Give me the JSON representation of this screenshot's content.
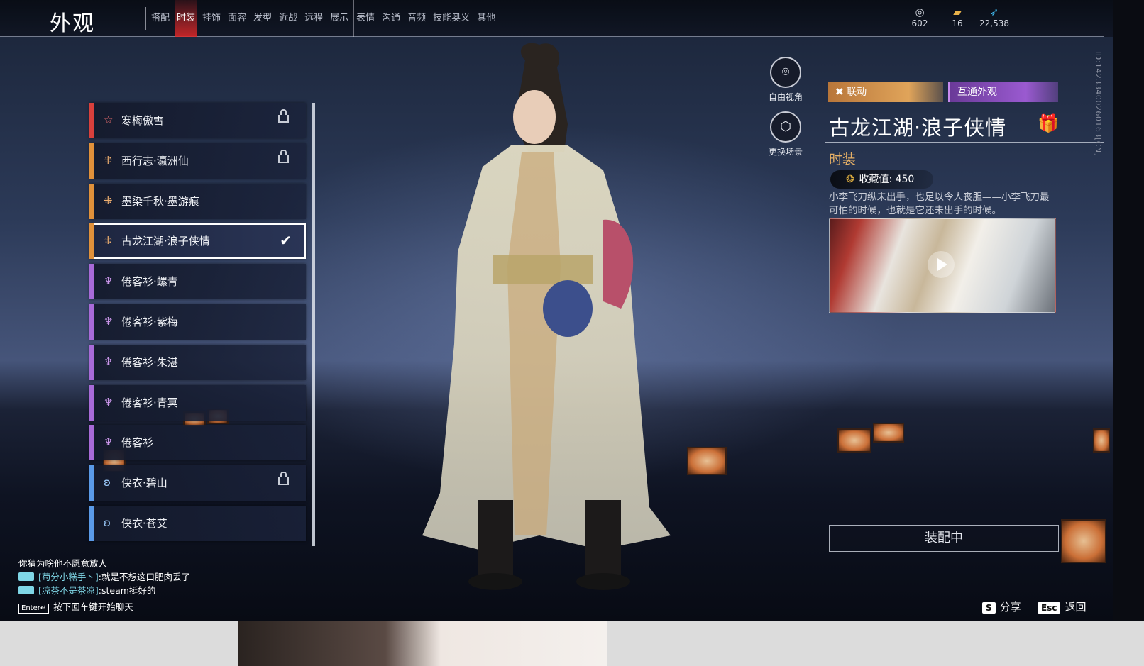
{
  "header": {
    "title": "外观",
    "tabs": [
      {
        "label": "搭配"
      },
      {
        "label": "时装",
        "active": true
      },
      {
        "label": "挂饰"
      },
      {
        "label": "面容"
      },
      {
        "label": "发型"
      },
      {
        "label": "近战"
      },
      {
        "label": "远程"
      },
      {
        "label": "展示"
      },
      {
        "label": "表情"
      },
      {
        "label": "沟通"
      },
      {
        "label": "音频"
      },
      {
        "label": "技能奥义"
      },
      {
        "label": "其他"
      }
    ],
    "currencies": [
      {
        "icon": "jade-icon",
        "value": "602"
      },
      {
        "icon": "ticket-icon",
        "value": "16"
      },
      {
        "icon": "feather-icon",
        "value": "22,538"
      }
    ]
  },
  "outfit_list": {
    "items": [
      {
        "label": "寒梅傲雪",
        "rarity_color": "#d8403c",
        "icon": "star-icon",
        "locked": true,
        "selected": false
      },
      {
        "label": "西行志·瀛洲仙",
        "rarity_color": "#e0913a",
        "icon": "cross-icon",
        "locked": true,
        "selected": false
      },
      {
        "label": "墨染千秋·墨游痕",
        "rarity_color": "#e0913a",
        "icon": "cross-icon",
        "locked": false,
        "selected": false
      },
      {
        "label": "古龙江湖·浪子侠情",
        "rarity_color": "#e0913a",
        "icon": "cross-icon",
        "locked": false,
        "selected": true
      },
      {
        "label": "倦客衫·螺青",
        "rarity_color": "#a86ad8",
        "icon": "trident-icon",
        "locked": false,
        "selected": false
      },
      {
        "label": "倦客衫·紫梅",
        "rarity_color": "#a86ad8",
        "icon": "trident-icon",
        "locked": false,
        "selected": false
      },
      {
        "label": "倦客衫·朱湛",
        "rarity_color": "#a86ad8",
        "icon": "trident-icon",
        "locked": false,
        "selected": false
      },
      {
        "label": "倦客衫·青冥",
        "rarity_color": "#a86ad8",
        "icon": "trident-icon",
        "locked": false,
        "selected": false
      },
      {
        "label": "倦客衫",
        "rarity_color": "#a86ad8",
        "icon": "trident-icon",
        "locked": false,
        "selected": false
      },
      {
        "label": "侠衣·碧山",
        "rarity_color": "#5a9ae8",
        "icon": "wings-icon",
        "locked": true,
        "selected": false
      },
      {
        "label": "侠衣·苍艾",
        "rarity_color": "#5a9ae8",
        "icon": "wings-icon",
        "locked": false,
        "selected": false
      }
    ]
  },
  "camera": {
    "free_view": "自由视角",
    "change_scene": "更换场景"
  },
  "detail": {
    "tag_collab": "联动",
    "tag_shared": "互通外观",
    "title": "古龙江湖·浪子侠情",
    "type": "时装",
    "collect_label": "收藏值: 450",
    "description": "小李飞刀纵未出手，也足以令人丧胆——小李飞刀最可怕的时候，也就是它还未出手的时候。",
    "equip_label": "装配中",
    "side_id": "ID:1423340026016​3[CN]"
  },
  "chat": {
    "line1": "你猜为啥他不愿意放人",
    "line2_name": "[苟分小糕手丶]",
    "line2_text": ":就是不想这口肥肉丢了",
    "line3_name": "[凉茶不是茶凉]",
    "line3_text": ":steam挺好的",
    "enter_key": "Enter↵",
    "enter_hint": "按下回车键开始聊天"
  },
  "hints": {
    "share_key": "S",
    "share_label": "分享",
    "back_key": "Esc",
    "back_label": "返回"
  },
  "colors": {
    "active_tab": "#e02828",
    "detail_type": "#e6b066",
    "chat_name": "#7fd6e6"
  }
}
